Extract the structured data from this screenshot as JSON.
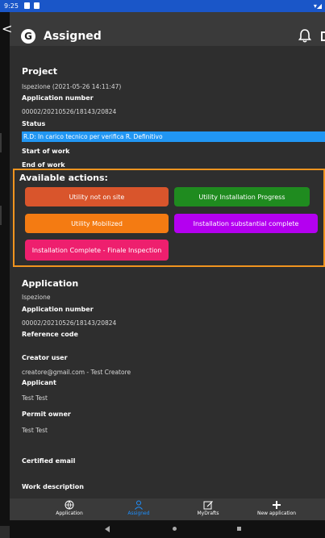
{
  "status_bar": {
    "time": "9:25",
    "wifi": "▾◢"
  },
  "header": {
    "back": "<",
    "logo_letter": "G",
    "title": "Assigned"
  },
  "project": {
    "heading": "Project",
    "name": "Ispezione (2021-05-26 14:11:47)",
    "app_number_label": "Application number",
    "app_number": "00002/20210526/18143/20824",
    "status_label": "Status",
    "status_value": "R.D: In carico tecnico per verifica R. Definitivo",
    "start_label": "Start of work",
    "end_label": "End of work"
  },
  "actions": {
    "title": "Available actions:",
    "buttons": [
      {
        "label": "Utility not on site",
        "color": "#d9552c"
      },
      {
        "label": "Utility Installation Progress",
        "color": "#1f8b1f"
      },
      {
        "label": "Utility Mobilized",
        "color": "#f47b12"
      },
      {
        "label": "Installation substantial complete",
        "color": "#b400f0"
      },
      {
        "label": "Installation Complete - Finale Inspection",
        "color": "#ee1f6e"
      }
    ]
  },
  "application": {
    "heading": "Application",
    "name": "Ispezione",
    "app_number_label": "Application number",
    "app_number": "00002/20210526/18143/20824",
    "reference_label": "Reference code",
    "creator_label": "Creator user",
    "creator_value": "creatore@gmail.com - Test Creatore",
    "applicant_label": "Applicant",
    "applicant_value": "Test Test",
    "permit_owner_label": "Permit owner",
    "permit_owner_value": "Test Test",
    "cert_email_label": "Certified email",
    "work_desc_label": "Work description"
  },
  "bottom_nav": [
    {
      "label": "Application",
      "icon": "globe-icon",
      "active": false
    },
    {
      "label": "Assigned",
      "icon": "person-icon",
      "active": true
    },
    {
      "label": "MyDrafts",
      "icon": "edit-icon",
      "active": false
    },
    {
      "label": "New application",
      "icon": "plus-icon",
      "active": false
    }
  ],
  "colors": {
    "accent": "#1e90ff",
    "status_bar": "#1a56c8",
    "status_value_bg": "#2196f3",
    "actions_border": "#f0941f"
  }
}
